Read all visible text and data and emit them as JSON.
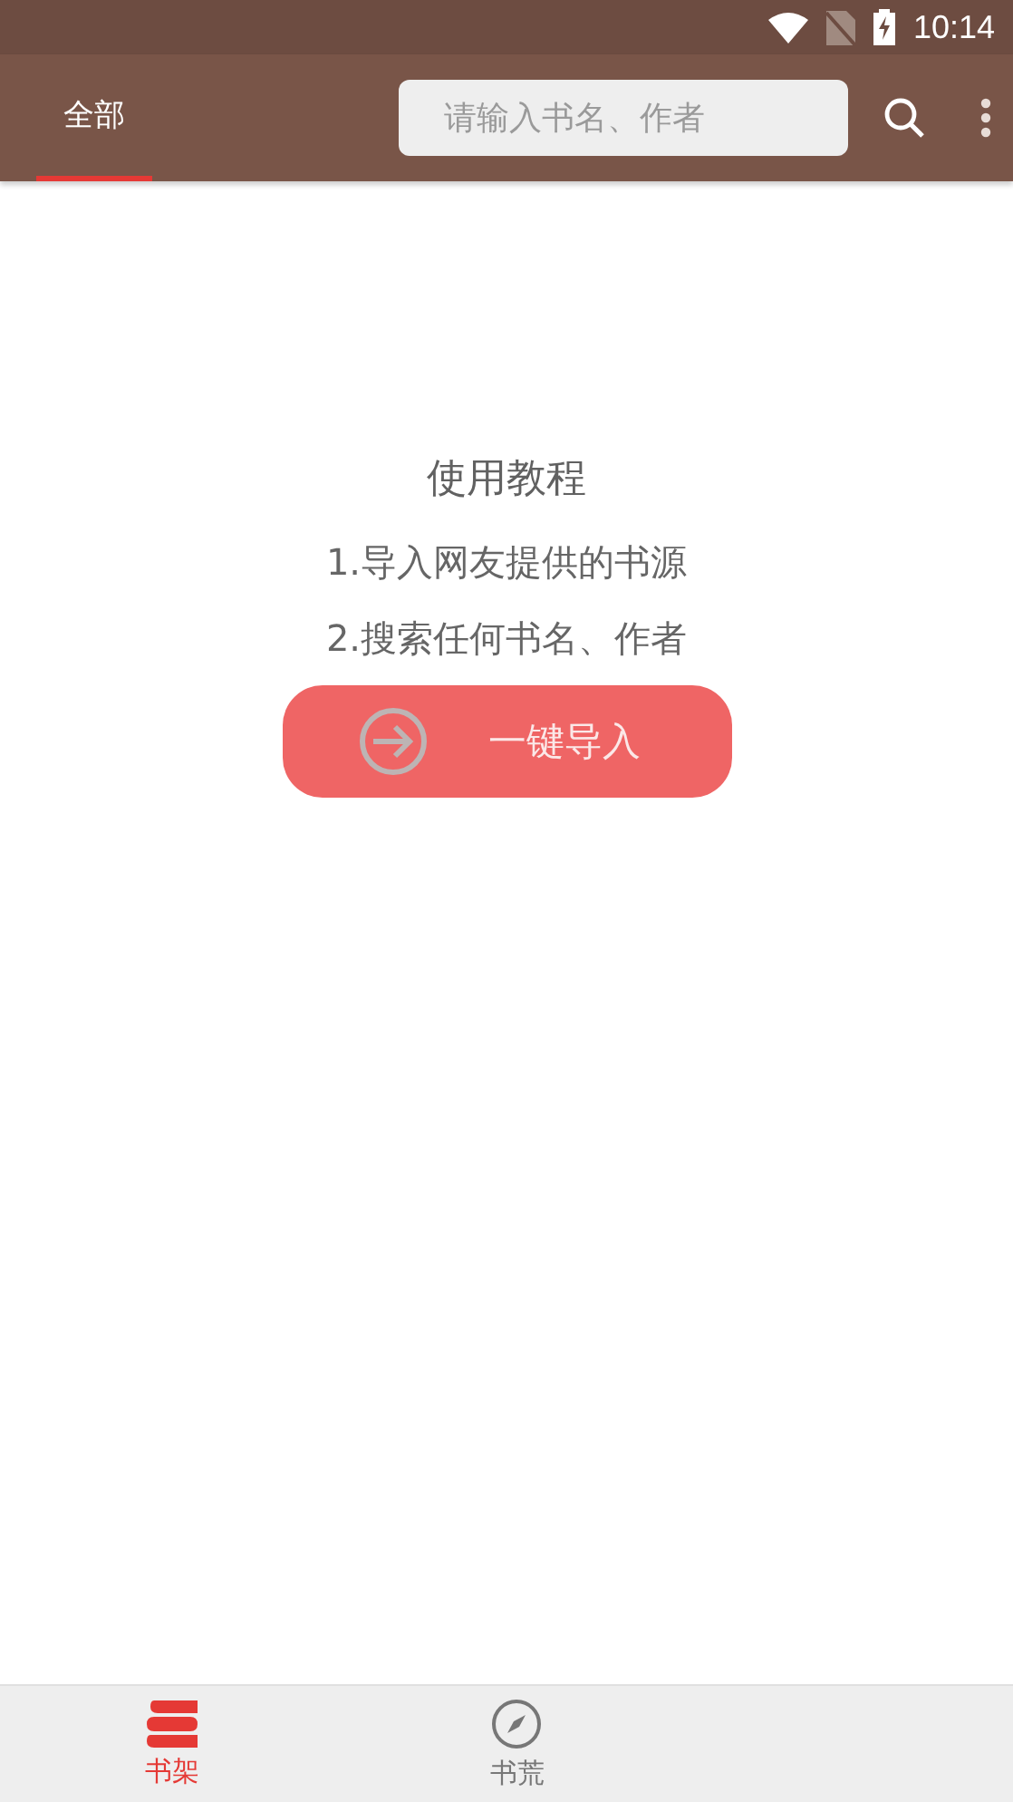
{
  "status_bar": {
    "time": "10:14"
  },
  "top_bar": {
    "tabs": [
      {
        "label": "全部",
        "selected": true
      }
    ],
    "search": {
      "placeholder": "请输入书名、作者"
    }
  },
  "tutorial": {
    "title": "使用教程",
    "steps": [
      "1.导入网友提供的书源",
      "2.搜索任何书名、作者"
    ],
    "import_button": "一键导入"
  },
  "bottom_nav": [
    {
      "kind": "shelf",
      "label": "书架",
      "selected": true
    },
    {
      "kind": "compass",
      "label": "书荒",
      "selected": false
    }
  ]
}
